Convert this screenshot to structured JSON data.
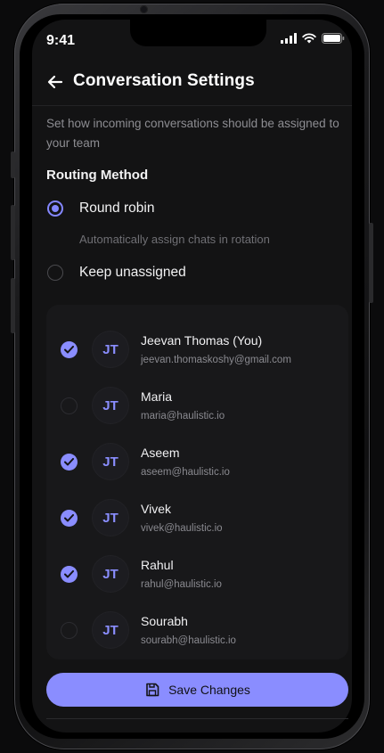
{
  "status_bar": {
    "time": "9:41"
  },
  "header": {
    "title": "Conversation Settings",
    "back_icon": "arrow-left-icon"
  },
  "description": "Set how incoming conversations should be assigned to your team",
  "routing": {
    "title": "Routing Method",
    "options": [
      {
        "label": "Round robin",
        "help": "Automatically assign chats in rotation",
        "selected": true
      },
      {
        "label": "Keep unassigned",
        "selected": false
      }
    ]
  },
  "members": [
    {
      "initials": "JT",
      "name": "Jeevan Thomas (You)",
      "email": "jeevan.thomaskoshy@gmail.com",
      "checked": true
    },
    {
      "initials": "JT",
      "name": "Maria",
      "email": "maria@haulistic.io",
      "checked": false
    },
    {
      "initials": "JT",
      "name": "Aseem",
      "email": "aseem@haulistic.io",
      "checked": true
    },
    {
      "initials": "JT",
      "name": "Vivek",
      "email": "vivek@haulistic.io",
      "checked": true
    },
    {
      "initials": "JT",
      "name": "Rahul",
      "email": "rahul@haulistic.io",
      "checked": true
    },
    {
      "initials": "JT",
      "name": "Sourabh",
      "email": "sourabh@haulistic.io",
      "checked": false
    }
  ],
  "save_button": {
    "label": "Save Changes",
    "icon": "save-icon"
  },
  "colors": {
    "accent": "#8a8dff",
    "background": "#131314",
    "card": "#18181a"
  }
}
